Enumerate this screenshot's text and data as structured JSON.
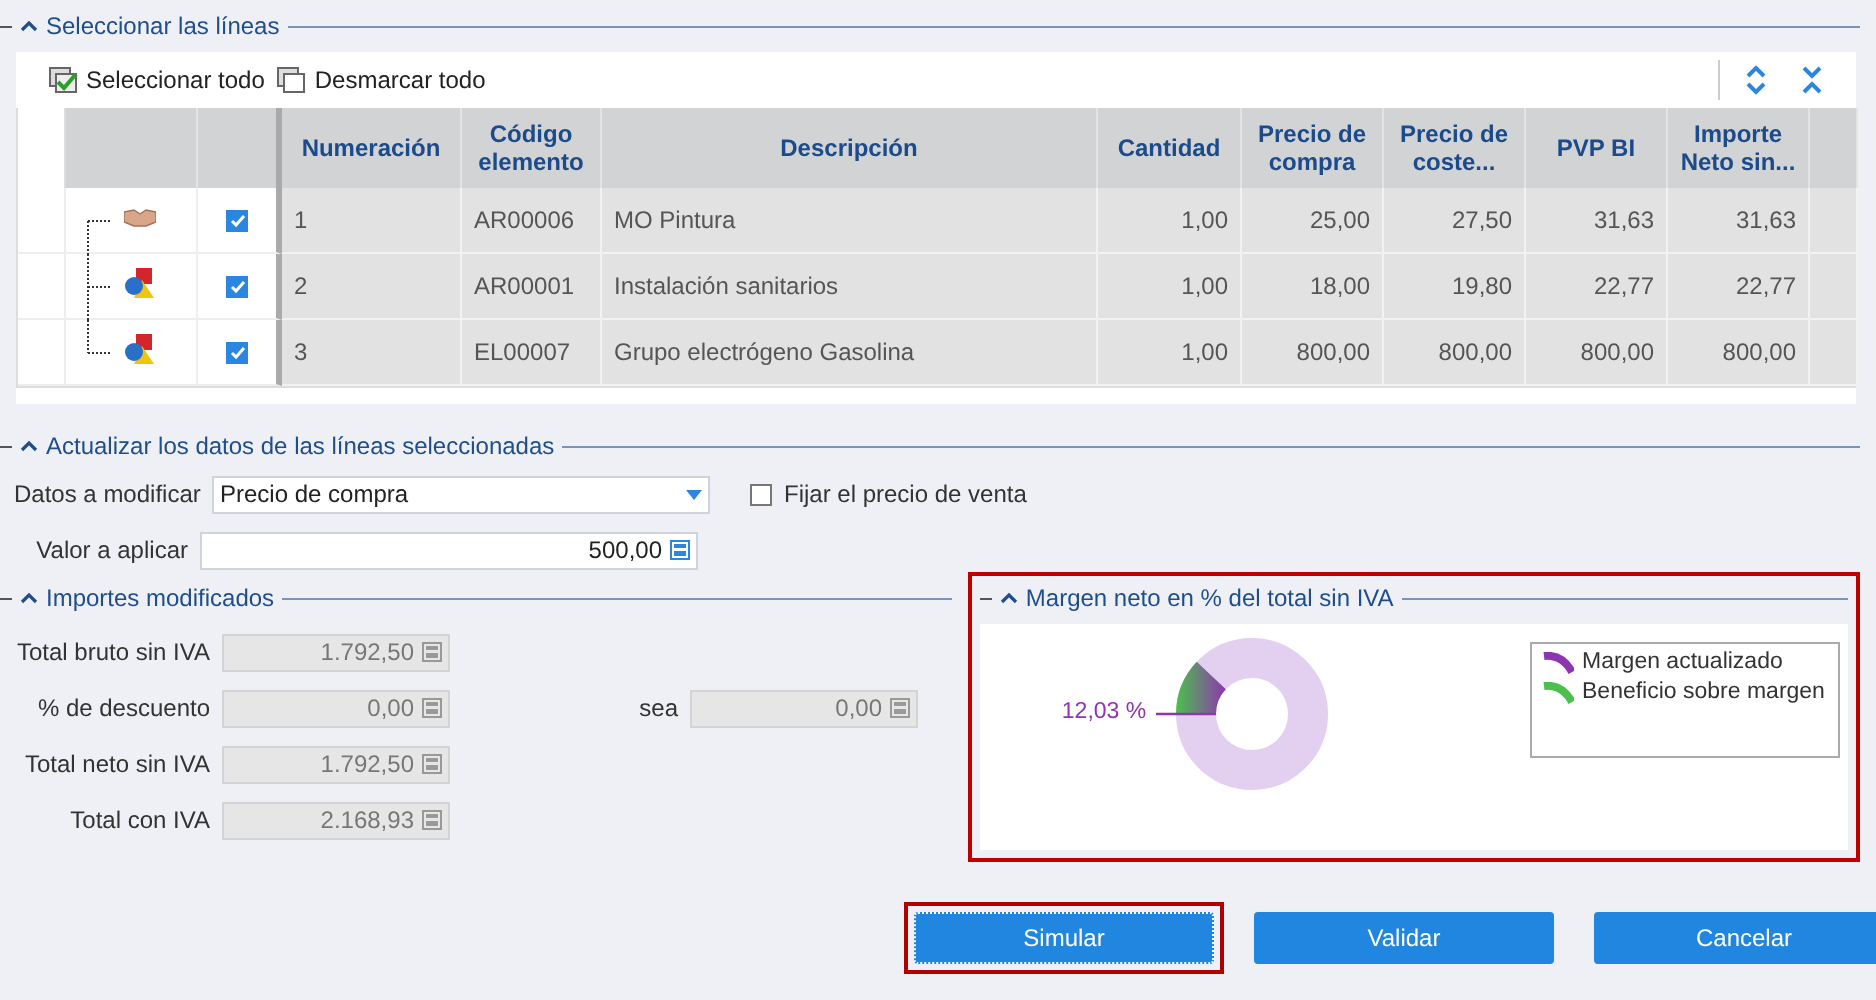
{
  "sections": {
    "lines": "Seleccionar las líneas",
    "update": "Actualizar los datos de las líneas seleccionadas",
    "amounts": "Importes modificados",
    "margin": "Margen neto en % del total sin IVA"
  },
  "toolbar": {
    "select_all": "Seleccionar todo",
    "unselect_all": "Desmarcar todo"
  },
  "table": {
    "columns": [
      "Numeración",
      "Código elemento",
      "Descripción",
      "Cantidad",
      "Precio de compra",
      "Precio de coste...",
      "PVP BI",
      "Importe Neto sin..."
    ],
    "rows": [
      {
        "kind": "labor",
        "checked": true,
        "cells": [
          "1",
          "AR00006",
          "MO Pintura",
          "1,00",
          "25,00",
          "27,50",
          "31,63",
          "31,63"
        ]
      },
      {
        "kind": "material",
        "checked": true,
        "cells": [
          "2",
          "AR00001",
          "Instalación sanitarios",
          "1,00",
          "18,00",
          "19,80",
          "22,77",
          "22,77"
        ]
      },
      {
        "kind": "material",
        "checked": true,
        "cells": [
          "3",
          "EL00007",
          "Grupo electrógeno Gasolina",
          "1,00",
          "800,00",
          "800,00",
          "800,00",
          "800,00"
        ]
      }
    ]
  },
  "update": {
    "field_label": "Datos a modificar",
    "field_value": "Precio de compra",
    "fix_price": {
      "label": "Fijar el precio de venta",
      "checked": false
    },
    "value_label": "Valor a aplicar",
    "value": "500,00"
  },
  "amounts": [
    {
      "label": "Total bruto sin IVA",
      "value": "1.792,50"
    },
    {
      "label": "% de descuento",
      "value": "0,00",
      "extra_label": "sea",
      "extra_value": "0,00"
    },
    {
      "label": "Total neto sin IVA",
      "value": "1.792,50"
    },
    {
      "label": "Total con IVA",
      "value": "2.168,93"
    }
  ],
  "margin_chart": {
    "highlighted": true,
    "reading": "12,03 %",
    "legend": [
      {
        "label": "Margen actualizado",
        "color": "#8e35b0"
      },
      {
        "label": "Beneficio sobre margen",
        "color": "#4cc04c"
      }
    ]
  },
  "buttons": [
    {
      "label": "Simular",
      "highlighted": true
    },
    {
      "label": "Validar",
      "highlighted": false
    },
    {
      "label": "Cancelar",
      "highlighted": false
    }
  ]
}
